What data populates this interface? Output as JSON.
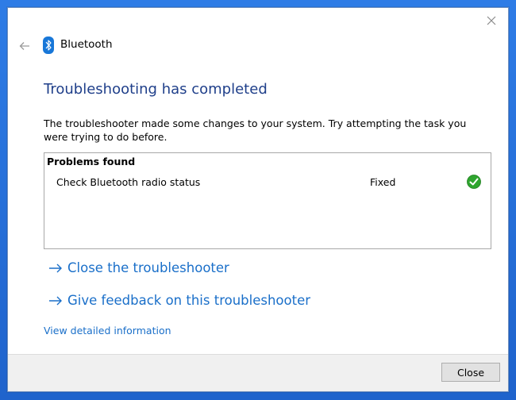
{
  "window": {
    "title": "Bluetooth",
    "close_icon": "close-icon",
    "back_icon": "back-arrow-icon",
    "app_icon": "bluetooth-icon"
  },
  "main": {
    "heading": "Troubleshooting has completed",
    "description": "The troubleshooter made some changes to your system. Try attempting the task you were trying to do before.",
    "problems": {
      "header": "Problems found",
      "items": [
        {
          "name": "Check Bluetooth radio status",
          "status": "Fixed",
          "status_icon": "green-check-icon"
        }
      ]
    },
    "links": {
      "close_troubleshooter": "Close the troubleshooter",
      "give_feedback": "Give feedback on this troubleshooter",
      "view_details": "View detailed information"
    }
  },
  "footer": {
    "close_label": "Close"
  },
  "colors": {
    "heading": "#1f3f8a",
    "link": "#1a6fc9",
    "check_green": "#2fa52f",
    "desktop": "#2a6fd6"
  }
}
